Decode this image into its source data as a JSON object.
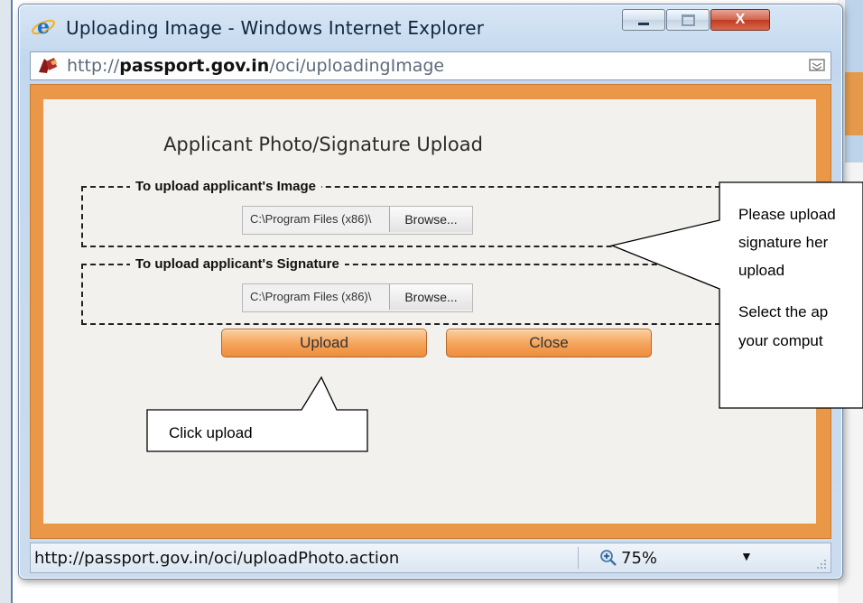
{
  "window": {
    "title": "Uploading Image - Windows Internet Explorer",
    "controls": {
      "minimize": "minimize",
      "maximize": "maximize",
      "close": "X"
    }
  },
  "address": {
    "url_prefix": "http://",
    "url_domain": "passport.gov.in",
    "url_path": "/oci/uploadingImage"
  },
  "dialog": {
    "title": "Applicant Photo/Signature Upload",
    "image_section": {
      "legend": "To upload applicant's Image",
      "file_path": "C:\\Program Files (x86)\\",
      "browse_label": "Browse..."
    },
    "signature_section": {
      "legend": "To upload applicant's Signature",
      "file_path": "C:\\Program Files (x86)\\",
      "browse_label": "Browse..."
    },
    "upload_label": "Upload",
    "close_label": "Close"
  },
  "status": {
    "url": "http://passport.gov.in/oci/uploadPhoto.action",
    "zoom": "75%"
  },
  "callouts": {
    "click_upload": "Click upload",
    "upload_line1": "Please upload",
    "upload_line2": "signature her",
    "upload_line3": "upload",
    "select_line1": "Select the ap",
    "select_line2": "your comput"
  },
  "colors": {
    "frame_orange": "#ea9848",
    "button_orange": "#f4a35a",
    "ie_blue": "#1e73c8"
  }
}
